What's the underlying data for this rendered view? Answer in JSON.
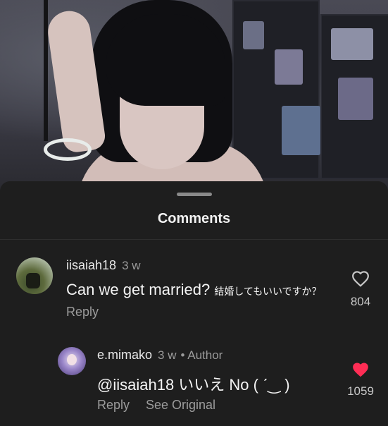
{
  "sheet": {
    "title": "Comments"
  },
  "comments": [
    {
      "username": "iisaiah18",
      "time": "3 w",
      "text": "Can we get married?",
      "text_extra": "結婚してもいいですか？",
      "reply_label": "Reply",
      "likes": "804",
      "liked": false
    },
    {
      "username": "e.mimako",
      "time": "3 w",
      "badge": "• Author",
      "text": "@iisaiah18 いいえ No ( ˊ‿ )",
      "reply_label": "Reply",
      "see_original_label": "See Original",
      "likes": "1059",
      "liked": true
    }
  ],
  "colors": {
    "sheet_bg": "#1e1e1e",
    "heart_liked": "#ff2d55",
    "muted": "#9a9a9a"
  },
  "icons": {
    "like_empty": "heart-outline-icon",
    "like_filled": "heart-filled-icon"
  }
}
